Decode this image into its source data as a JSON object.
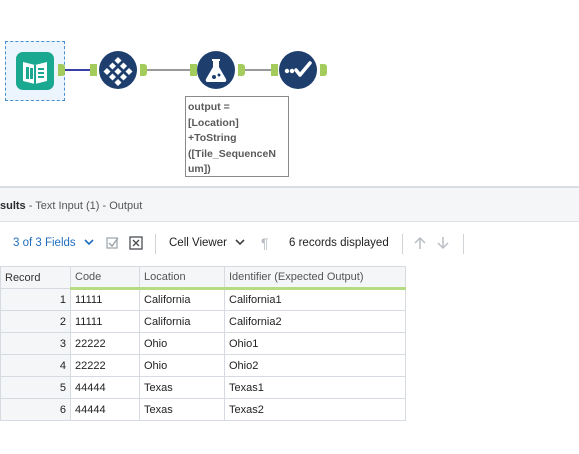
{
  "workflow": {
    "tools": [
      {
        "name": "Text Input",
        "color": "#1aa890",
        "icon": "book-icon"
      },
      {
        "name": "Tile",
        "color": "#1e3f6e",
        "icon": "tile-grid-icon"
      },
      {
        "name": "Formula",
        "color": "#1e3f6e",
        "icon": "flask-icon"
      },
      {
        "name": "Browse / Test",
        "color": "#1e3f6e",
        "icon": "checkmark-icon"
      }
    ],
    "annotation_lines": [
      "output =",
      "[Location]",
      "+ToString",
      "([Tile_SequenceN",
      "um])"
    ]
  },
  "results": {
    "title_bold": "sults",
    "title_sub": "- Text Input (1) - Output"
  },
  "toolbar": {
    "fields_label": "3 of 3 Fields",
    "cell_viewer_label": "Cell Viewer",
    "records_displayed": "6 records displayed"
  },
  "table": {
    "columns": [
      "Record",
      "Code",
      "Location",
      "Identifier (Expected Output)"
    ],
    "rows": [
      [
        "1",
        "11111",
        "California",
        "California1"
      ],
      [
        "2",
        "11111",
        "California",
        "California2"
      ],
      [
        "3",
        "22222",
        "Ohio",
        "Ohio1"
      ],
      [
        "4",
        "22222",
        "Ohio",
        "Ohio2"
      ],
      [
        "5",
        "44444",
        "Texas",
        "Texas1"
      ],
      [
        "6",
        "44444",
        "Texas",
        "Texas2"
      ]
    ]
  },
  "colors": {
    "accent_green": "#a3cc5c",
    "link_blue": "#1f6dbf",
    "tool_navy": "#1e3f6e",
    "tool_teal": "#1aa890"
  }
}
